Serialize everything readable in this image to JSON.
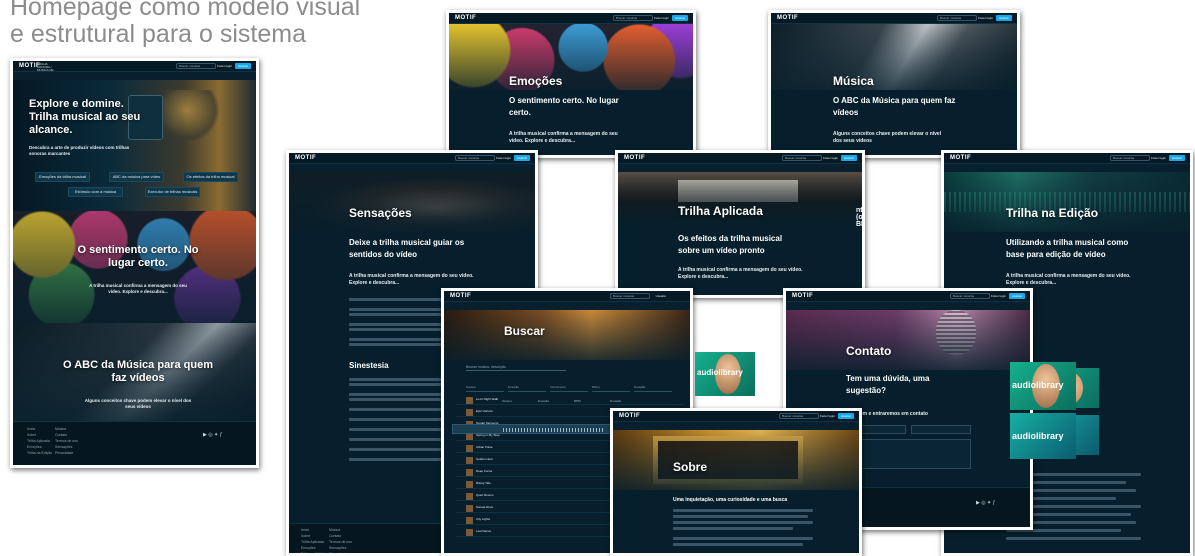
{
  "caption": {
    "line1": "Homepage como modelo visual",
    "line2": "e estrutural para o sistema"
  },
  "brand": {
    "logo": "MOTIF",
    "tagline": "TRILHA SONORA / MÚSICA DE FUNDO",
    "search": "Buscar músicas",
    "login": "Fazer login",
    "signup": "Assinar"
  },
  "home": {
    "nav": [
      "Início",
      "Emoções",
      "Música",
      "Trilha Aplicada",
      "Sensações",
      "Trilha na Edição",
      "Sobre",
      "Contato"
    ],
    "hero_title": "Explore e domine. Trilha musical ao seu alcance.",
    "hero_sub": "Descubra a arte de produzir vídeos com trilhas sonoras marcantes",
    "buttons": [
      "Emoções da trilha musical",
      "ABC da música para vídeo",
      "Os efeitos da trilha musical",
      "Estímulo com a música",
      "Executor de trilhas musicais"
    ],
    "section1_title": "O sentimento certo. No lugar certo.",
    "section1_text": "A trilha musical confirma a mensagem do seu vídeo. Explore e descubra...",
    "section2_title": "O ABC da Música para quem faz vídeos",
    "section2_text": "Alguns conceitos chave podem elevar o nível dos seus vídeos",
    "footer_links": [
      "Início",
      "Música",
      "Sobre",
      "Contato",
      "Trilha Aplicada",
      "Termos de uso",
      "Emoções",
      "Sensações",
      "Trilha na Edição",
      "Privacidade"
    ]
  },
  "pages": {
    "emocoes": {
      "title": "Emoções",
      "sub": "O sentimento certo. No lugar certo.",
      "small": "A trilha musical confirma a mensagem do seu vídeo. Explore e descubra..."
    },
    "musica": {
      "title": "Música",
      "sub": "O ABC da Música para quem faz vídeos",
      "small": "Alguns conceitos chave podem elevar o nível dos seus vídeos"
    },
    "sensacoes": {
      "title": "Sensações",
      "sub": "Deixe a trilha musical guiar os sentidos do vídeo",
      "small": "A trilha musical confirma a mensagem do seu vídeo. Explore e descubra...",
      "section": "Sinestesia"
    },
    "trilha_aplicada": {
      "title": "Trilha Aplicada",
      "sub": "Os efeitos da trilha musical sobre um vídeo pronto",
      "small": "A trilha musical confirma a mensagem do seu vídeo. Explore e descubra...",
      "behind": "nto (ou BPM)"
    },
    "trilha_edicao": {
      "title": "Trilha na Edição",
      "sub": "Utilizando a trilha musical como base para edição de vídeo",
      "small": "A trilha musical confirma a mensagem do seu vídeo. Explore e descubra..."
    },
    "buscar": {
      "title": "Buscar",
      "search_placeholder": "Buscar música, descrição",
      "filters": [
        "Gênero",
        "Emoção",
        "Instrumento",
        "Ritmo",
        "Duração"
      ],
      "columns": [
        "Faixa",
        "Gênero",
        "Emoção",
        "BPM",
        "Duração"
      ],
      "user": "Usuário",
      "tracks": [
        "Lo-Fi Night Walk",
        "Epic Horizon",
        "Tender Moments",
        "Spring in My Step",
        "Urban Pulse",
        "Golden Hour",
        "Deep Focus",
        "Rising Tide",
        "Quiet Rooms",
        "Sunset Drive",
        "City Lights",
        "Last Dance"
      ]
    },
    "contato": {
      "title": "Contato",
      "sub": "Tem uma dúvida, uma sugestão?",
      "small": "mensagem e entraremos em contato",
      "badge1": "audiolibrary",
      "badge2": "audiolibrary"
    },
    "sobre": {
      "title": "Sobre",
      "sub": "Uma inquietação, uma curiosidade e uma busca"
    },
    "audiolibrary": "audiolibrary"
  },
  "colors": {
    "page_bg": "#071f2c",
    "accent": "#1aa7e6",
    "caption": "#8c8c8c"
  }
}
